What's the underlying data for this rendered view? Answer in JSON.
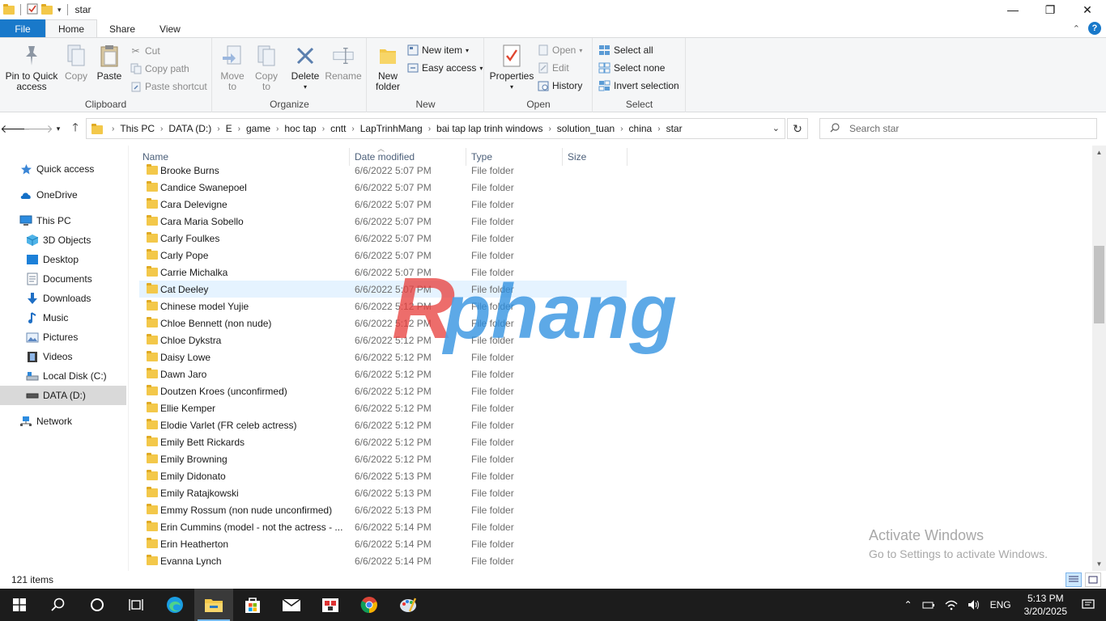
{
  "window": {
    "title": "star",
    "controls": {
      "minimize": "—",
      "maximize": "❐",
      "close": "✕"
    }
  },
  "ribbon_tabs": [
    {
      "label": "File"
    },
    {
      "label": "Home"
    },
    {
      "label": "Share"
    },
    {
      "label": "View"
    }
  ],
  "ribbon": {
    "clipboard": {
      "label": "Clipboard",
      "pin": "Pin to Quick access",
      "pin_line1": "Pin to Quick",
      "pin_line2": "access",
      "copy": "Copy",
      "paste": "Paste",
      "cut": "Cut",
      "copy_path": "Copy path",
      "paste_shortcut": "Paste shortcut"
    },
    "organize": {
      "label": "Organize",
      "move_to_1": "Move",
      "move_to_2": "to",
      "copy_to_1": "Copy",
      "copy_to_2": "to",
      "delete": "Delete",
      "rename": "Rename"
    },
    "new": {
      "label": "New",
      "new_folder_1": "New",
      "new_folder_2": "folder",
      "new_item": "New item",
      "easy_access": "Easy access"
    },
    "open": {
      "label": "Open",
      "properties": "Properties",
      "open": "Open",
      "edit": "Edit",
      "history": "History"
    },
    "select": {
      "label": "Select",
      "select_all": "Select all",
      "select_none": "Select none",
      "invert_selection": "Invert selection"
    }
  },
  "address": {
    "crumbs": [
      "This PC",
      "DATA (D:)",
      "E",
      "game",
      "hoc tap",
      "cntt",
      "LapTrinhMang",
      "bai tap lap trinh windows",
      "solution_tuan",
      "china",
      "star"
    ]
  },
  "search": {
    "placeholder": "Search star"
  },
  "nav_pane": {
    "items": [
      {
        "label": "Quick access",
        "icon": "star-icon"
      },
      {
        "label": "OneDrive",
        "icon": "cloud-icon"
      },
      {
        "label": "This PC",
        "icon": "computer-icon"
      },
      {
        "label": "3D Objects",
        "icon": "cube-icon"
      },
      {
        "label": "Desktop",
        "icon": "desktop-icon"
      },
      {
        "label": "Documents",
        "icon": "document-icon"
      },
      {
        "label": "Downloads",
        "icon": "download-icon"
      },
      {
        "label": "Music",
        "icon": "music-icon"
      },
      {
        "label": "Pictures",
        "icon": "pictures-icon"
      },
      {
        "label": "Videos",
        "icon": "video-icon"
      },
      {
        "label": "Local Disk (C:)",
        "icon": "drive-icon"
      },
      {
        "label": "DATA (D:)",
        "icon": "drive-icon"
      },
      {
        "label": "Network",
        "icon": "network-icon"
      }
    ]
  },
  "columns": {
    "name": "Name",
    "date": "Date modified",
    "type": "Type",
    "size": "Size"
  },
  "files": [
    {
      "name": "Brooke Burns",
      "date": "6/6/2022 5:07 PM",
      "type": "File folder"
    },
    {
      "name": "Candice Swanepoel",
      "date": "6/6/2022 5:07 PM",
      "type": "File folder"
    },
    {
      "name": "Cara Delevigne",
      "date": "6/6/2022 5:07 PM",
      "type": "File folder"
    },
    {
      "name": "Cara Maria Sobello",
      "date": "6/6/2022 5:07 PM",
      "type": "File folder"
    },
    {
      "name": "Carly Foulkes",
      "date": "6/6/2022 5:07 PM",
      "type": "File folder"
    },
    {
      "name": "Carly Pope",
      "date": "6/6/2022 5:07 PM",
      "type": "File folder"
    },
    {
      "name": "Carrie Michalka",
      "date": "6/6/2022 5:07 PM",
      "type": "File folder"
    },
    {
      "name": "Cat Deeley",
      "date": "6/6/2022 5:07 PM",
      "type": "File folder"
    },
    {
      "name": "Chinese model Yujie",
      "date": "6/6/2022 5:12 PM",
      "type": "File folder"
    },
    {
      "name": "Chloe Bennett (non nude)",
      "date": "6/6/2022 5:12 PM",
      "type": "File folder"
    },
    {
      "name": "Chloe Dykstra",
      "date": "6/6/2022 5:12 PM",
      "type": "File folder"
    },
    {
      "name": "Daisy Lowe",
      "date": "6/6/2022 5:12 PM",
      "type": "File folder"
    },
    {
      "name": "Dawn Jaro",
      "date": "6/6/2022 5:12 PM",
      "type": "File folder"
    },
    {
      "name": "Doutzen Kroes (unconfirmed)",
      "date": "6/6/2022 5:12 PM",
      "type": "File folder"
    },
    {
      "name": "Ellie Kemper",
      "date": "6/6/2022 5:12 PM",
      "type": "File folder"
    },
    {
      "name": "Elodie Varlet (FR celeb actress)",
      "date": "6/6/2022 5:12 PM",
      "type": "File folder"
    },
    {
      "name": "Emily Bett Rickards",
      "date": "6/6/2022 5:12 PM",
      "type": "File folder"
    },
    {
      "name": "Emily Browning",
      "date": "6/6/2022 5:12 PM",
      "type": "File folder"
    },
    {
      "name": "Emily Didonato",
      "date": "6/6/2022 5:13 PM",
      "type": "File folder"
    },
    {
      "name": "Emily Ratajkowski",
      "date": "6/6/2022 5:13 PM",
      "type": "File folder"
    },
    {
      "name": "Emmy Rossum (non nude unconfirmed)",
      "date": "6/6/2022 5:13 PM",
      "type": "File folder"
    },
    {
      "name": "Erin Cummins (model - not the actress - ...",
      "date": "6/6/2022 5:14 PM",
      "type": "File folder"
    },
    {
      "name": "Erin Heatherton",
      "date": "6/6/2022 5:14 PM",
      "type": "File folder"
    },
    {
      "name": "Evanna Lynch",
      "date": "6/6/2022 5:14 PM",
      "type": "File folder"
    }
  ],
  "status": {
    "item_count": "121 items"
  },
  "watermark": {
    "activate_line1": "Activate Windows",
    "activate_line2": "Go to Settings to activate Windows.",
    "logo_text": "Rphang"
  },
  "taskbar": {
    "language": "ENG",
    "time": "5:13 PM",
    "date": "3/20/2025"
  },
  "colors": {
    "accent": "#1979ca",
    "folder": "#f3c84a",
    "hover_row": "#e5f3ff",
    "selected_nav": "#d9d9d9",
    "taskbar": "#1c1c1c"
  }
}
